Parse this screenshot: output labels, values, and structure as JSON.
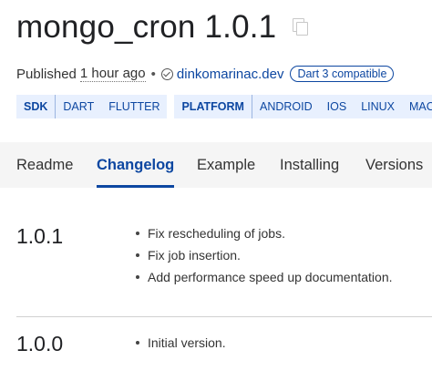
{
  "package": {
    "title": "mongo_cron 1.0.1"
  },
  "meta": {
    "published_label": "Published",
    "published_time": "1 hour ago",
    "separator": "•",
    "publisher": "dinkomarinac.dev",
    "compat_badge": "Dart 3 compatible"
  },
  "tags": {
    "sdk": {
      "label": "SDK",
      "items": [
        "DART",
        "FLUTTER"
      ]
    },
    "platform": {
      "label": "PLATFORM",
      "items": [
        "ANDROID",
        "IOS",
        "LINUX",
        "MACOS"
      ]
    }
  },
  "tabs": [
    {
      "label": "Readme",
      "active": false
    },
    {
      "label": "Changelog",
      "active": true
    },
    {
      "label": "Example",
      "active": false
    },
    {
      "label": "Installing",
      "active": false
    },
    {
      "label": "Versions",
      "active": false
    }
  ],
  "changelog": [
    {
      "version": "1.0.1",
      "changes": [
        "Fix rescheduling of jobs.",
        "Fix job insertion.",
        "Add performance speed up documentation."
      ]
    },
    {
      "version": "1.0.0",
      "changes": [
        "Initial version."
      ]
    }
  ],
  "colors": {
    "accent": "#0d47a1",
    "tag_bg": "#e8f0fe",
    "tabs_bg": "#f5f5f5"
  }
}
